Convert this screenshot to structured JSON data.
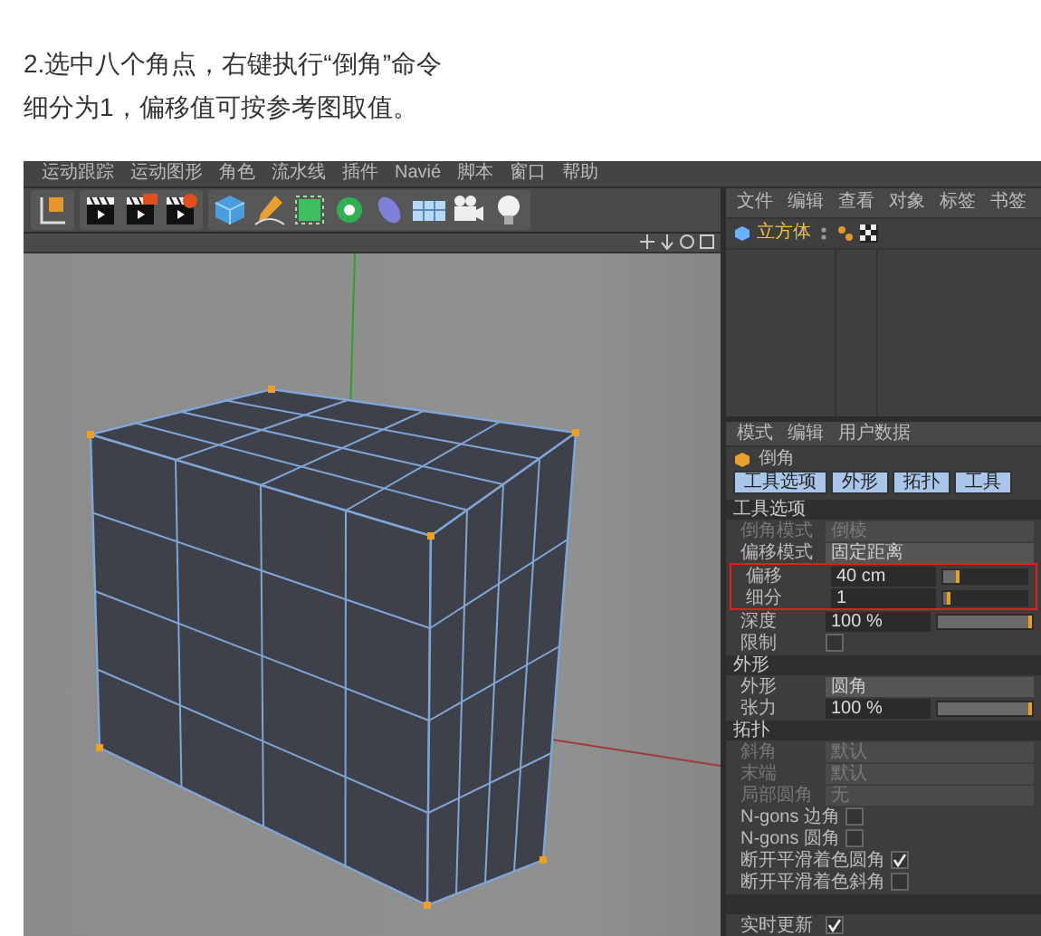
{
  "instructions": [
    "2.选中八个角点，右键执行“倒角”命令",
    "细分为1，偏移值可按参考图取值。"
  ],
  "menu_bar": [
    "运动跟踪",
    "运动图形",
    "角色",
    "流水线",
    "插件",
    "Navié",
    "脚本",
    "窗口",
    "帮助"
  ],
  "object_manager": {
    "menu": [
      "文件",
      "编辑",
      "查看",
      "对象",
      "标签",
      "书签"
    ],
    "objects": [
      {
        "name": "立方体",
        "selected": true
      }
    ]
  },
  "attributes": {
    "menu": [
      "模式",
      "编辑",
      "用户数据"
    ],
    "title": "倒角",
    "tabs": [
      {
        "label": "工具选项",
        "selected": true
      },
      {
        "label": "外形",
        "selected": true
      },
      {
        "label": "拓扑",
        "selected": true
      },
      {
        "label": "工具",
        "selected": true
      }
    ],
    "sections": [
      {
        "title": "工具选项",
        "rows": [
          {
            "kind": "dropdown",
            "label": "倒角模式",
            "value": "倒棱",
            "disabled": true
          },
          {
            "kind": "dropdown",
            "label": "偏移模式",
            "value": "固定距离",
            "disabled": false
          },
          {
            "kind": "number",
            "label": "偏移",
            "value": "40 cm",
            "level": 0.2,
            "highlighted": true
          },
          {
            "kind": "number",
            "label": "细分",
            "value": "1",
            "level": 0.08,
            "highlighted": true
          },
          {
            "kind": "number",
            "label": "深度",
            "value": "100 %",
            "level": 1,
            "highlighted": false
          },
          {
            "kind": "checkbox",
            "label": "限制",
            "checked": false
          }
        ]
      },
      {
        "title": "外形",
        "rows": [
          {
            "kind": "dropdown",
            "label": "外形",
            "value": "圆角",
            "disabled": false
          },
          {
            "kind": "number",
            "label": "张力",
            "value": "100 %",
            "level": 1,
            "highlighted": false
          }
        ]
      },
      {
        "title": "拓扑",
        "rows": [
          {
            "kind": "dropdown",
            "label": "斜角",
            "value": "默认",
            "disabled": true
          },
          {
            "kind": "dropdown",
            "label": "末端",
            "value": "默认",
            "disabled": true
          },
          {
            "kind": "dropdown",
            "label": "局部圆角",
            "value": "无",
            "disabled": true
          },
          {
            "kind": "checkbox",
            "label": "N-gons 边角",
            "checked": false
          },
          {
            "kind": "checkbox",
            "label": "N-gons 圆角",
            "checked": false
          },
          {
            "kind": "checkbox",
            "label": "断开平滑着色圆角",
            "checked": true
          },
          {
            "kind": "checkbox",
            "label": "断开平滑着色斜角",
            "checked": false
          }
        ]
      },
      {
        "rows": [
          {
            "kind": "checkbox",
            "label": "实时更新",
            "checked": true
          }
        ]
      }
    ]
  }
}
